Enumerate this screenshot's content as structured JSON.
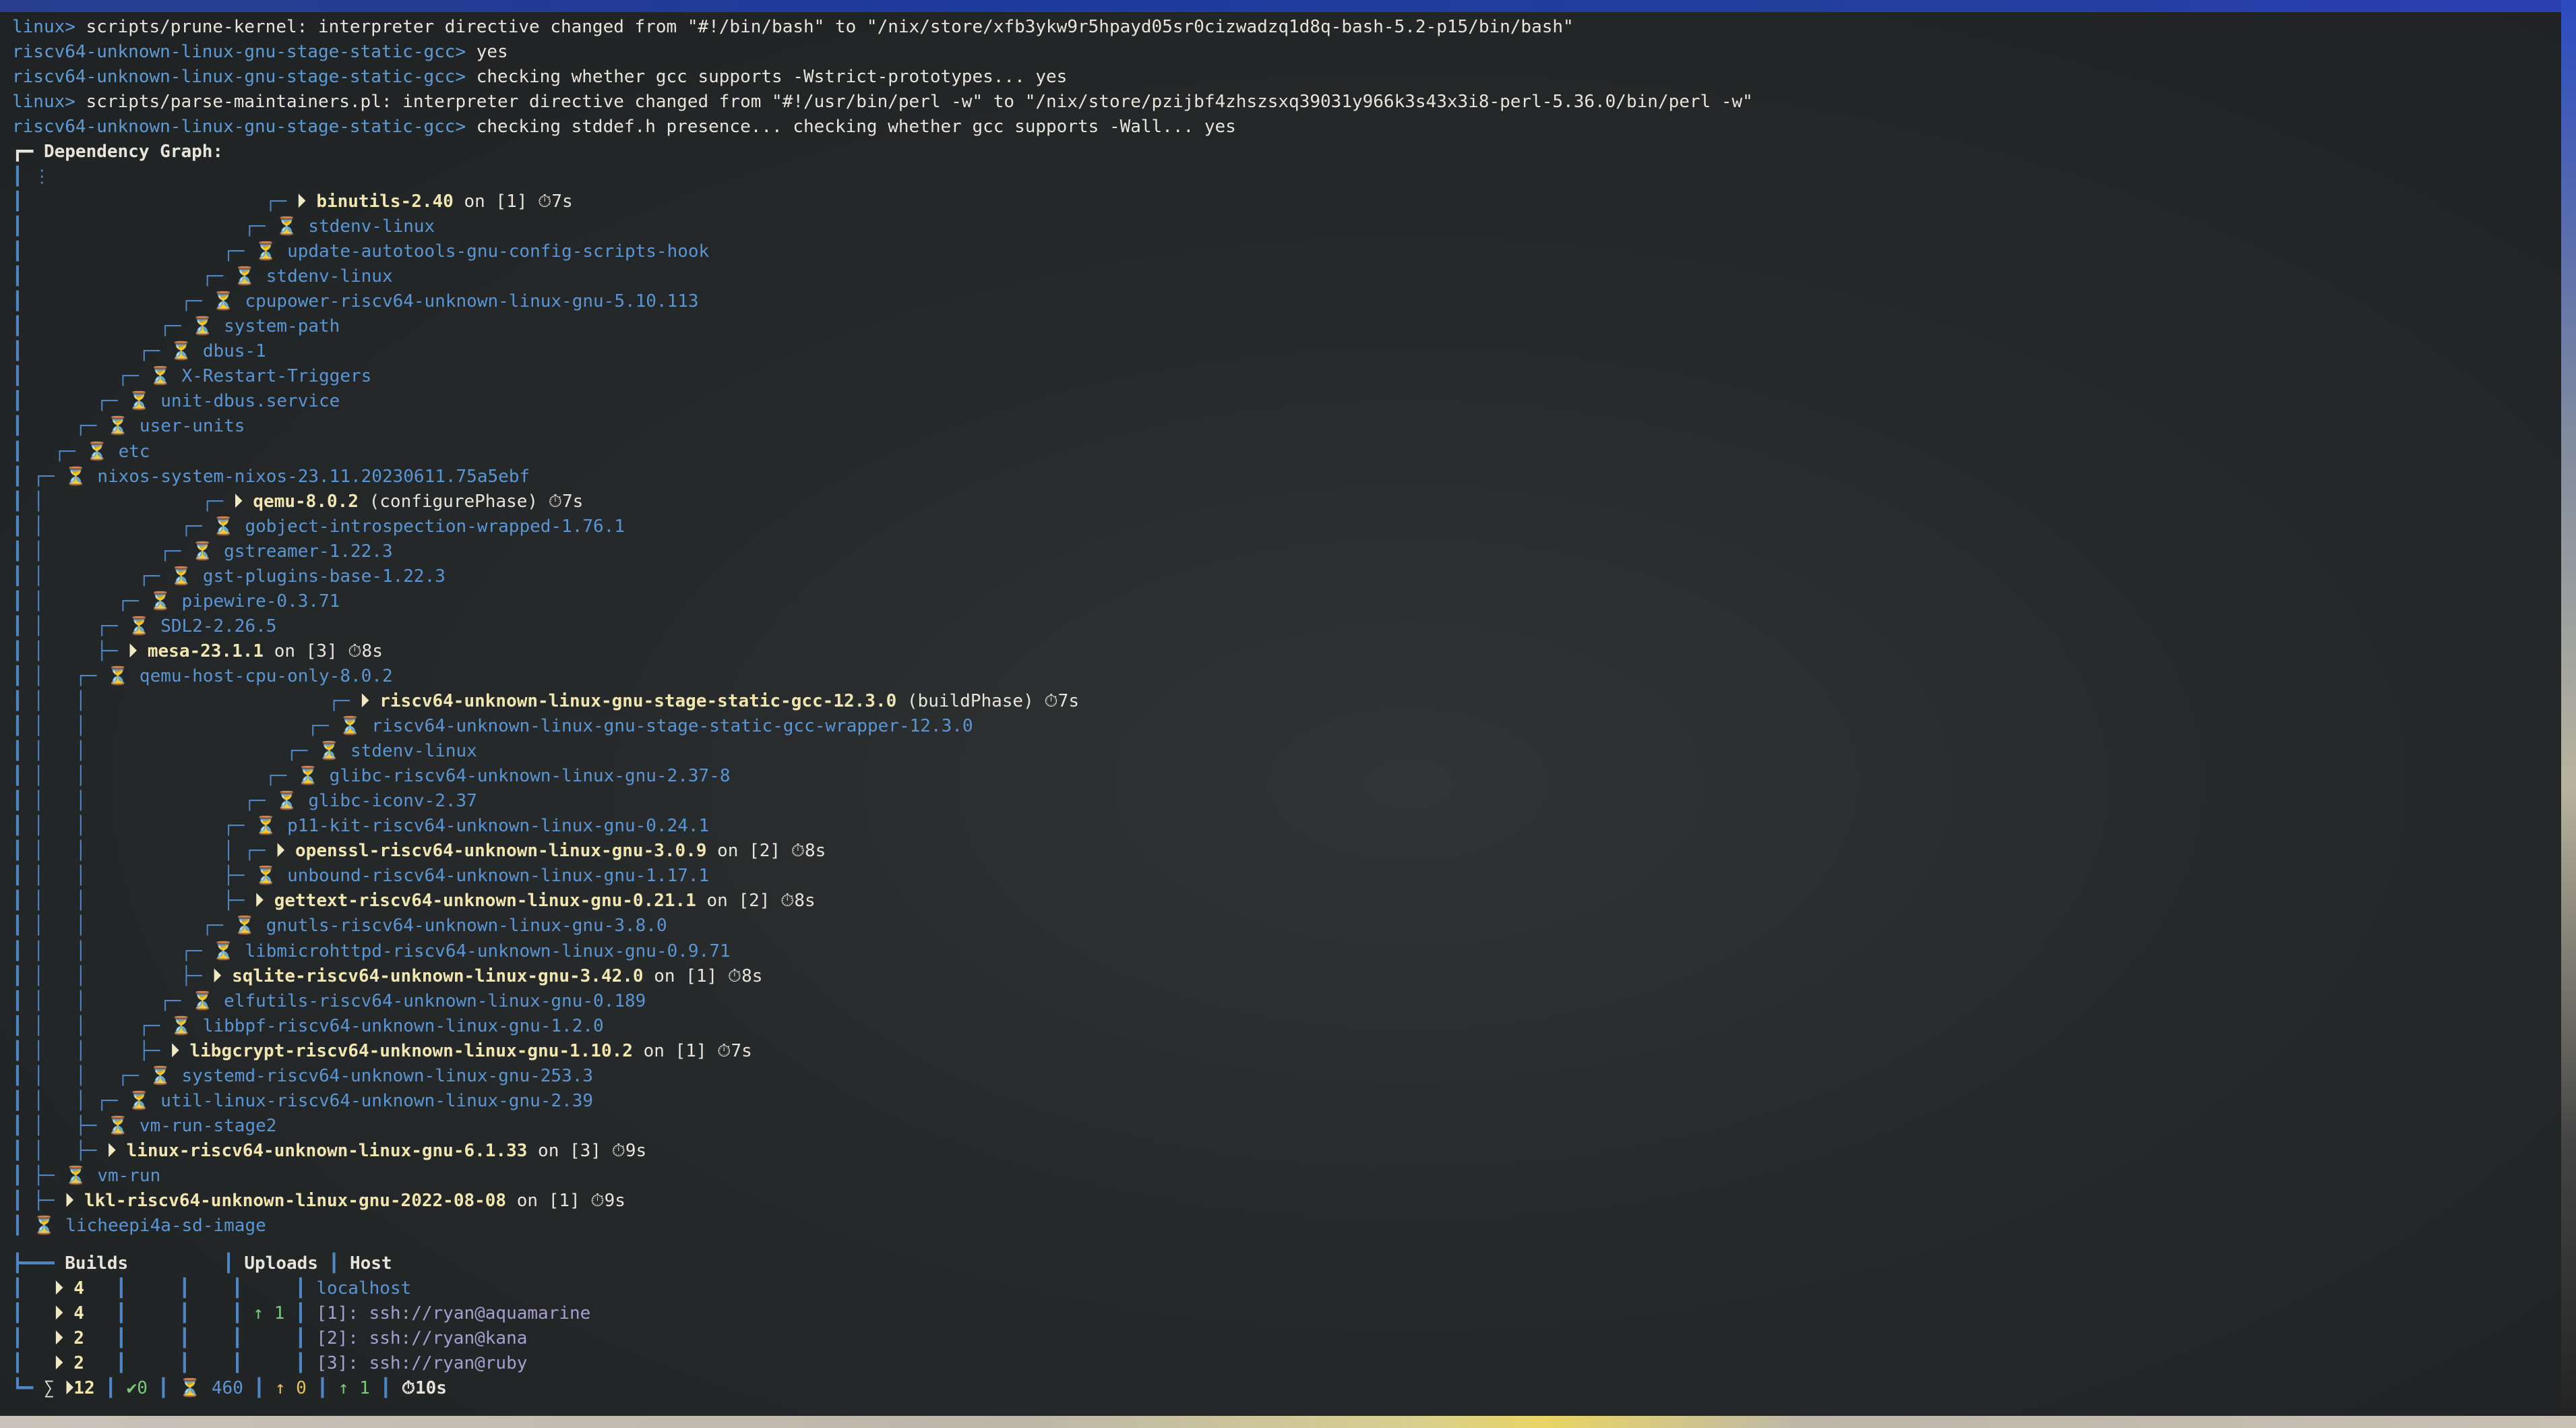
{
  "terminal": {
    "log_lines": [
      {
        "prompt": "linux>",
        "text": " scripts/prune-kernel: interpreter directive changed from \"#!/bin/bash\" to \"/nix/store/xfb3ykw9r5hpayd05sr0cizwadzq1d8q-bash-5.2-p15/bin/bash\""
      },
      {
        "prompt": "riscv64-unknown-linux-gnu-stage-static-gcc>",
        "text": " yes"
      },
      {
        "prompt": "riscv64-unknown-linux-gnu-stage-static-gcc>",
        "text": " checking whether gcc supports -Wstrict-prototypes... yes"
      },
      {
        "prompt": "linux>",
        "text": " scripts/parse-maintainers.pl: interpreter directive changed from \"#!/usr/bin/perl -w\" to \"/nix/store/pzijbf4zhszsxq39031y966k3s43x3i8-perl-5.36.0/bin/perl -w\""
      },
      {
        "prompt": "riscv64-unknown-linux-gnu-stage-static-gcc>",
        "text": " checking stddef.h presence... checking whether gcc supports -Wall... yes"
      }
    ],
    "graph_header": "┏━ Dependency Graph:",
    "graph_ellipsis": "┃ ⋮",
    "tree_lines": [
      {
        "prefix": "┃                       ┌─ ",
        "icon": "⏵",
        "name": "binutils-2.40",
        "running": true,
        "suffix": " on [1] ⏱7s"
      },
      {
        "prefix": "┃                     ┌─ ",
        "icon": "⏳",
        "name": "stdenv-linux",
        "running": false,
        "suffix": ""
      },
      {
        "prefix": "┃                   ┌─ ",
        "icon": "⏳",
        "name": "update-autotools-gnu-config-scripts-hook",
        "running": false,
        "suffix": ""
      },
      {
        "prefix": "┃                 ┌─ ",
        "icon": "⏳",
        "name": "stdenv-linux",
        "running": false,
        "suffix": ""
      },
      {
        "prefix": "┃               ┌─ ",
        "icon": "⏳",
        "name": "cpupower-riscv64-unknown-linux-gnu-5.10.113",
        "running": false,
        "suffix": ""
      },
      {
        "prefix": "┃             ┌─ ",
        "icon": "⏳",
        "name": "system-path",
        "running": false,
        "suffix": ""
      },
      {
        "prefix": "┃           ┌─ ",
        "icon": "⏳",
        "name": "dbus-1",
        "running": false,
        "suffix": ""
      },
      {
        "prefix": "┃         ┌─ ",
        "icon": "⏳",
        "name": "X-Restart-Triggers",
        "running": false,
        "suffix": ""
      },
      {
        "prefix": "┃       ┌─ ",
        "icon": "⏳",
        "name": "unit-dbus.service",
        "running": false,
        "suffix": ""
      },
      {
        "prefix": "┃     ┌─ ",
        "icon": "⏳",
        "name": "user-units",
        "running": false,
        "suffix": ""
      },
      {
        "prefix": "┃   ┌─ ",
        "icon": "⏳",
        "name": "etc",
        "running": false,
        "suffix": ""
      },
      {
        "prefix": "┃ ┌─ ",
        "icon": "⏳",
        "name": "nixos-system-nixos-23.11.20230611.75a5ebf",
        "running": false,
        "suffix": ""
      },
      {
        "prefix": "┃ │               ┌─ ",
        "icon": "⏵",
        "name": "qemu-8.0.2",
        "running": true,
        "suffix": " (configurePhase) ⏱7s"
      },
      {
        "prefix": "┃ │             ┌─ ",
        "icon": "⏳",
        "name": "gobject-introspection-wrapped-1.76.1",
        "running": false,
        "suffix": ""
      },
      {
        "prefix": "┃ │           ┌─ ",
        "icon": "⏳",
        "name": "gstreamer-1.22.3",
        "running": false,
        "suffix": ""
      },
      {
        "prefix": "┃ │         ┌─ ",
        "icon": "⏳",
        "name": "gst-plugins-base-1.22.3",
        "running": false,
        "suffix": ""
      },
      {
        "prefix": "┃ │       ┌─ ",
        "icon": "⏳",
        "name": "pipewire-0.3.71",
        "running": false,
        "suffix": ""
      },
      {
        "prefix": "┃ │     ┌─ ",
        "icon": "⏳",
        "name": "SDL2-2.26.5",
        "running": false,
        "suffix": ""
      },
      {
        "prefix": "┃ │     ├─ ",
        "icon": "⏵",
        "name": "mesa-23.1.1",
        "running": true,
        "suffix": " on [3] ⏱8s"
      },
      {
        "prefix": "┃ │   ┌─ ",
        "icon": "⏳",
        "name": "qemu-host-cpu-only-8.0.2",
        "running": false,
        "suffix": ""
      },
      {
        "prefix": "┃ │   │                       ┌─ ",
        "icon": "⏵",
        "name": "riscv64-unknown-linux-gnu-stage-static-gcc-12.3.0",
        "running": true,
        "suffix": " (buildPhase) ⏱7s"
      },
      {
        "prefix": "┃ │   │                     ┌─ ",
        "icon": "⏳",
        "name": "riscv64-unknown-linux-gnu-stage-static-gcc-wrapper-12.3.0",
        "running": false,
        "suffix": ""
      },
      {
        "prefix": "┃ │   │                   ┌─ ",
        "icon": "⏳",
        "name": "stdenv-linux",
        "running": false,
        "suffix": ""
      },
      {
        "prefix": "┃ │   │                 ┌─ ",
        "icon": "⏳",
        "name": "glibc-riscv64-unknown-linux-gnu-2.37-8",
        "running": false,
        "suffix": ""
      },
      {
        "prefix": "┃ │   │               ┌─ ",
        "icon": "⏳",
        "name": "glibc-iconv-2.37",
        "running": false,
        "suffix": ""
      },
      {
        "prefix": "┃ │   │             ┌─ ",
        "icon": "⏳",
        "name": "p11-kit-riscv64-unknown-linux-gnu-0.24.1",
        "running": false,
        "suffix": ""
      },
      {
        "prefix": "┃ │   │             │ ┌─ ",
        "icon": "⏵",
        "name": "openssl-riscv64-unknown-linux-gnu-3.0.9",
        "running": true,
        "suffix": " on [2] ⏱8s"
      },
      {
        "prefix": "┃ │   │             ├─ ",
        "icon": "⏳",
        "name": "unbound-riscv64-unknown-linux-gnu-1.17.1",
        "running": false,
        "suffix": ""
      },
      {
        "prefix": "┃ │   │             ├─ ",
        "icon": "⏵",
        "name": "gettext-riscv64-unknown-linux-gnu-0.21.1",
        "running": true,
        "suffix": " on [2] ⏱8s"
      },
      {
        "prefix": "┃ │   │           ┌─ ",
        "icon": "⏳",
        "name": "gnutls-riscv64-unknown-linux-gnu-3.8.0",
        "running": false,
        "suffix": ""
      },
      {
        "prefix": "┃ │   │         ┌─ ",
        "icon": "⏳",
        "name": "libmicrohttpd-riscv64-unknown-linux-gnu-0.9.71",
        "running": false,
        "suffix": ""
      },
      {
        "prefix": "┃ │   │         ├─ ",
        "icon": "⏵",
        "name": "sqlite-riscv64-unknown-linux-gnu-3.42.0",
        "running": true,
        "suffix": " on [1] ⏱8s"
      },
      {
        "prefix": "┃ │   │       ┌─ ",
        "icon": "⏳",
        "name": "elfutils-riscv64-unknown-linux-gnu-0.189",
        "running": false,
        "suffix": ""
      },
      {
        "prefix": "┃ │   │     ┌─ ",
        "icon": "⏳",
        "name": "libbpf-riscv64-unknown-linux-gnu-1.2.0",
        "running": false,
        "suffix": ""
      },
      {
        "prefix": "┃ │   │     ├─ ",
        "icon": "⏵",
        "name": "libgcrypt-riscv64-unknown-linux-gnu-1.10.2",
        "running": true,
        "suffix": " on [1] ⏱7s"
      },
      {
        "prefix": "┃ │   │   ┌─ ",
        "icon": "⏳",
        "name": "systemd-riscv64-unknown-linux-gnu-253.3",
        "running": false,
        "suffix": ""
      },
      {
        "prefix": "┃ │   │ ┌─ ",
        "icon": "⏳",
        "name": "util-linux-riscv64-unknown-linux-gnu-2.39",
        "running": false,
        "suffix": ""
      },
      {
        "prefix": "┃ │   ├─ ",
        "icon": "⏳",
        "name": "vm-run-stage2",
        "running": false,
        "suffix": ""
      },
      {
        "prefix": "┃ │   ├─ ",
        "icon": "⏵",
        "name": "linux-riscv64-unknown-linux-gnu-6.1.33",
        "running": true,
        "suffix": " on [3] ⏱9s"
      },
      {
        "prefix": "┃ ├─ ",
        "icon": "⏳",
        "name": "vm-run",
        "running": false,
        "suffix": ""
      },
      {
        "prefix": "┃ ├─ ",
        "icon": "⏵",
        "name": "lkl-riscv64-unknown-linux-gnu-2022-08-08",
        "running": true,
        "suffix": " on [1] ⏱9s"
      },
      {
        "prefix": "┃ ",
        "icon": "⏳",
        "name": "licheepi4a-sd-image",
        "running": false,
        "suffix": ""
      }
    ],
    "summary_table": {
      "header": {
        "builds": "Builds",
        "uploads": "Uploads",
        "host": "Host"
      },
      "rows": [
        {
          "builds": "4",
          "uploads": "",
          "host": "localhost"
        },
        {
          "builds": "4",
          "uploads": "↑ 1",
          "host": "[1]: ssh://ryan@aquamarine"
        },
        {
          "builds": "2",
          "uploads": "",
          "host": "[2]: ssh://ryan@kana"
        },
        {
          "builds": "2",
          "uploads": "",
          "host": "[3]: ssh://ryan@ruby"
        }
      ],
      "totals": {
        "sigma": "∑",
        "running": "12",
        "done": "✔0",
        "waiting": "460",
        "uploads_done": "↑ 0",
        "uploads_running": "↑ 1",
        "elapsed": "⏱10s"
      }
    }
  },
  "colors": {
    "prompt": "#5d9bd6",
    "tree_lines": "#4f86c6",
    "running_name": "#f1e6b0",
    "waiting_icon": "#e8c15a",
    "upload_green": "#7cc97c"
  }
}
